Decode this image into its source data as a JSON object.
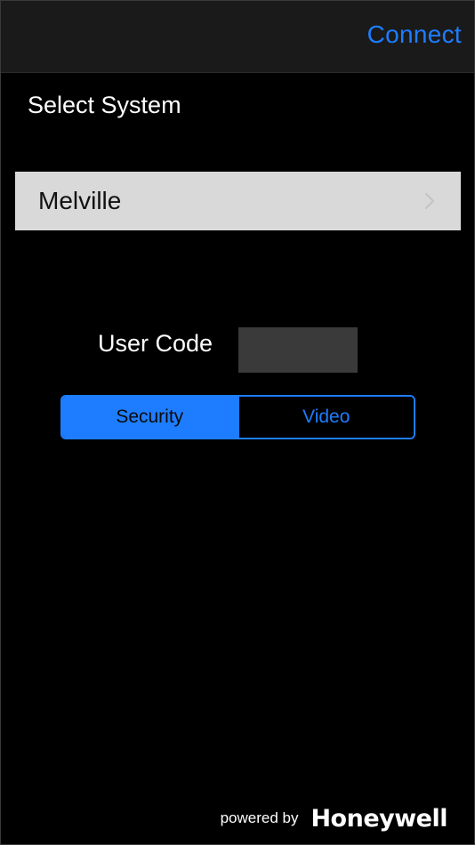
{
  "navbar": {
    "connect_label": "Connect"
  },
  "section": {
    "title": "Select System"
  },
  "system": {
    "selected": "Melville",
    "chevron_icon": "chevron-right-icon"
  },
  "user_code": {
    "label": "User Code",
    "value": "",
    "placeholder": ""
  },
  "mode": {
    "segments": [
      {
        "label": "Security",
        "selected": true
      },
      {
        "label": "Video",
        "selected": false
      }
    ]
  },
  "footer": {
    "powered_by": "powered by",
    "brand": "Honeywell"
  },
  "colors": {
    "accent": "#1e7dff",
    "background": "#000000",
    "navbar": "#1a1a1a",
    "row_background": "#d9d9d9",
    "input_background": "#3a3a3a"
  }
}
